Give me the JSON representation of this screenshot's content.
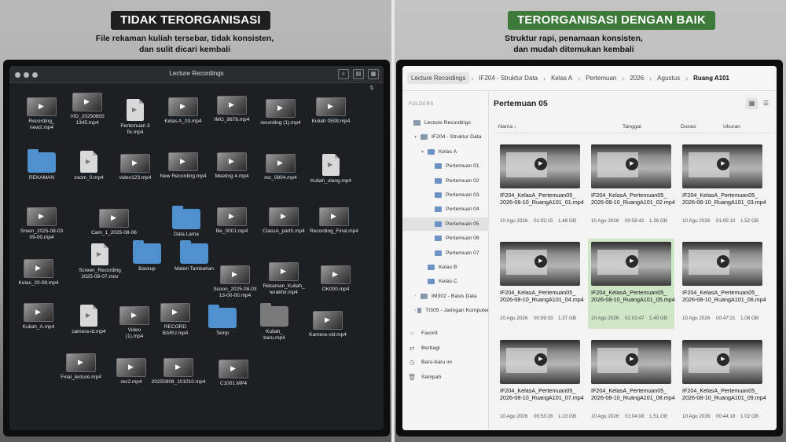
{
  "left": {
    "badge": "TIDAK TERORGANISASI",
    "subtitle": "File rekaman kuliah tersebar, tidak konsisten,\ndan sulit dicari kembali",
    "window_title": "Lecture Recordings",
    "files": [
      {
        "label": "Recording_\nnew2.mp4",
        "icon": "video-thumb"
      },
      {
        "label": "VID_20250805\n1345.mp4",
        "icon": "video-thumb"
      },
      {
        "label": "Pertemuan 3\nfix.mp4",
        "icon": "video-file-icon"
      },
      {
        "label": "Kelas A_03.mp4",
        "icon": "video-thumb"
      },
      {
        "label": "IMG_9876.mp4",
        "icon": "video-thumb"
      },
      {
        "label": "recording (1).mp4",
        "icon": "video-thumb"
      },
      {
        "label": "Kuliah 0508.mp4",
        "icon": "video-thumb"
      },
      {
        "label": "REKAMAN",
        "icon": "folder-icon"
      },
      {
        "label": "zoom_0.mp4",
        "icon": "video-file-icon"
      },
      {
        "label": "video123.mp4",
        "icon": "video-thumb"
      },
      {
        "label": "New Recording.mp4",
        "icon": "video-thumb"
      },
      {
        "label": "Meeting 4.mp4",
        "icon": "video-thumb"
      },
      {
        "label": "rec_0804.mp4",
        "icon": "video-thumb"
      },
      {
        "label": "Kuliah_ulang.mp4",
        "icon": "video-file-icon"
      },
      {
        "label": "Sreen_2025-08-03\n09-00.mp4",
        "icon": "video-thumb"
      },
      {
        "label": "Cam_1_2025-08-06",
        "icon": "video-thumb"
      },
      {
        "label": "Data Lama",
        "icon": "folder-icon"
      },
      {
        "label": "file_0001.mp4",
        "icon": "video-thumb"
      },
      {
        "label": "ClassA_part5.mp4",
        "icon": "video-thumb"
      },
      {
        "label": "Recording_Final.mp4",
        "icon": "video-thumb"
      },
      {
        "label": "Screen_Recording\n2025-08-07.mov",
        "icon": "video-file-icon"
      },
      {
        "label": "Backup",
        "icon": "folder-icon"
      },
      {
        "label": "Materi Tambahan",
        "icon": "folder-icon"
      },
      {
        "label": "Kelas_20-08.mp4",
        "icon": "video-thumb"
      },
      {
        "label": "Scoon_2025-08-03\n13-00-00.mp4",
        "icon": "video-thumb"
      },
      {
        "label": "Rekaman_Kuliah_\nterakhir.mp4",
        "icon": "video-thumb"
      },
      {
        "label": "OK000.mp4",
        "icon": "video-thumb"
      },
      {
        "label": "Kuliah_A.mp4",
        "icon": "video-thumb"
      },
      {
        "label": "camera-id.mp4",
        "icon": "video-file-icon"
      },
      {
        "label": "Video\n(1).mp4",
        "icon": "video-thumb"
      },
      {
        "label": "RECORD\nBARU.mp4",
        "icon": "video-thumb"
      },
      {
        "label": "Temp",
        "icon": "folder-icon"
      },
      {
        "label": "Kuliah_\nbaru.mp4",
        "icon": "video-file-icon"
      },
      {
        "label": "Kamera-vid.mp4",
        "icon": "video-thumb"
      },
      {
        "label": "Final_lecture.mp4",
        "icon": "video-thumb"
      },
      {
        "label": "rec2.mp4",
        "icon": "video-thumb"
      },
      {
        "label": "20250808_101010.mp4",
        "icon": "video-thumb"
      },
      {
        "label": "C1001.MP4",
        "icon": "video-thumb"
      }
    ]
  },
  "right": {
    "badge": "TERORGANISASI DENGAN BAIK",
    "subtitle": "Struktur rapi, penamaan konsisten,\ndan mudah ditemukan kembali",
    "breadcrumbs": [
      "Lecture Recordings",
      "IF204 - Struktur Data",
      "Kelas A",
      "Pertemuan",
      "2026",
      "Agustus",
      "Ruang A101"
    ],
    "sidebar_header": "FOLDERS",
    "tree": [
      {
        "label": "Lecture Recordings",
        "level": 0,
        "arrow": ""
      },
      {
        "label": "IF204 - Struktur Data",
        "level": 1,
        "arrow": "▾"
      },
      {
        "label": "Kelas A",
        "level": 2,
        "arrow": "▾"
      },
      {
        "label": "Pertemuan 01",
        "level": 3,
        "arrow": ""
      },
      {
        "label": "Pertemuan 02",
        "level": 3,
        "arrow": ""
      },
      {
        "label": "Pertemuan 03",
        "level": 3,
        "arrow": ""
      },
      {
        "label": "Pertemuan 04",
        "level": 3,
        "arrow": ""
      },
      {
        "label": "Pertemuan 05",
        "level": 3,
        "arrow": "",
        "selected": true
      },
      {
        "label": "Pertemuan 06",
        "level": 3,
        "arrow": ""
      },
      {
        "label": "Pertemuan 07",
        "level": 3,
        "arrow": ""
      },
      {
        "label": "Kelas B",
        "level": 2,
        "arrow": ""
      },
      {
        "label": "Kelas C",
        "level": 2,
        "arrow": ""
      },
      {
        "label": "IM302 - Basis Data",
        "level": 1,
        "arrow": "›"
      },
      {
        "label": "TI305 - Jaringan Komputer",
        "level": 1,
        "arrow": "›"
      }
    ],
    "quick_links": [
      {
        "label": "Favorit",
        "icon": "star-icon"
      },
      {
        "label": "Berbagi",
        "icon": "share-icon"
      },
      {
        "label": "Baru-baru ini",
        "icon": "clock-icon"
      },
      {
        "label": "Sampah",
        "icon": "trash-icon"
      }
    ],
    "folder_title": "Pertemuan 05",
    "columns": {
      "name": "Nama ↓",
      "date": "Tanggal",
      "duration": "Durasi",
      "size": "Ukuran"
    },
    "videos": [
      {
        "name": "IF204_KelasA_Pertemuan05_\n2026-08-10_RuangA101_01.mp4",
        "date": "10 Agu 2026",
        "duration": "01:02:15",
        "size": "1.48 GB"
      },
      {
        "name": "IF204_KelasA_Pertemuan05_\n2026-08-10_RuangA101_02.mp4",
        "date": "10 Agu 2026",
        "duration": "00:58:42",
        "size": "1.36 GB"
      },
      {
        "name": "IF204_KelasA_Pertemuan05_\n2026-08-10_RuangA101_03.mp4",
        "date": "10 Agu 2026",
        "duration": "01:05:10",
        "size": "1.52 GB"
      },
      {
        "name": "IF204_KelasA_Pertemuan05_\n2026-08-10_RuangA101_04.mp4",
        "date": "10 Agu 2026",
        "duration": "00:59:33",
        "size": "1.37 GB"
      },
      {
        "name": "IF204_KelasA_Pertemuan05_\n2026-08-10_RuangA101_05.mp4",
        "date": "10 Agu 2026",
        "duration": "01:03:47",
        "size": "1.49 GB",
        "highlight": true
      },
      {
        "name": "IF204_KelasA_Pertemuan05_\n2026-08-10_RuangA101_06.mp4",
        "date": "10 Agu 2026",
        "duration": "00:47:21",
        "size": "1.08 GB"
      },
      {
        "name": "IF204_KelasA_Pertemuan05_\n2026-08-10_RuangA101_07.mp4",
        "date": "10 Agu 2026",
        "duration": "00:53:26",
        "size": "1.23 GB"
      },
      {
        "name": "IF204_KelasA_Pertemuan05_\n2026-08-10_RuangA101_08.mp4",
        "date": "10 Agu 2026",
        "duration": "01:04:08",
        "size": "1.51 GB"
      },
      {
        "name": "IF204_KelasA_Pertemuan05_\n2026-08-10_RuangA101_09.mp4",
        "date": "10 Agu 2026",
        "duration": "00:44:18",
        "size": "1.02 GB"
      }
    ]
  },
  "colors": {
    "badge_dark": "#1f1f1f",
    "badge_green": "#3d7a3a",
    "highlight": "#cfe6c6",
    "folder_blue": "#4f91cf"
  }
}
